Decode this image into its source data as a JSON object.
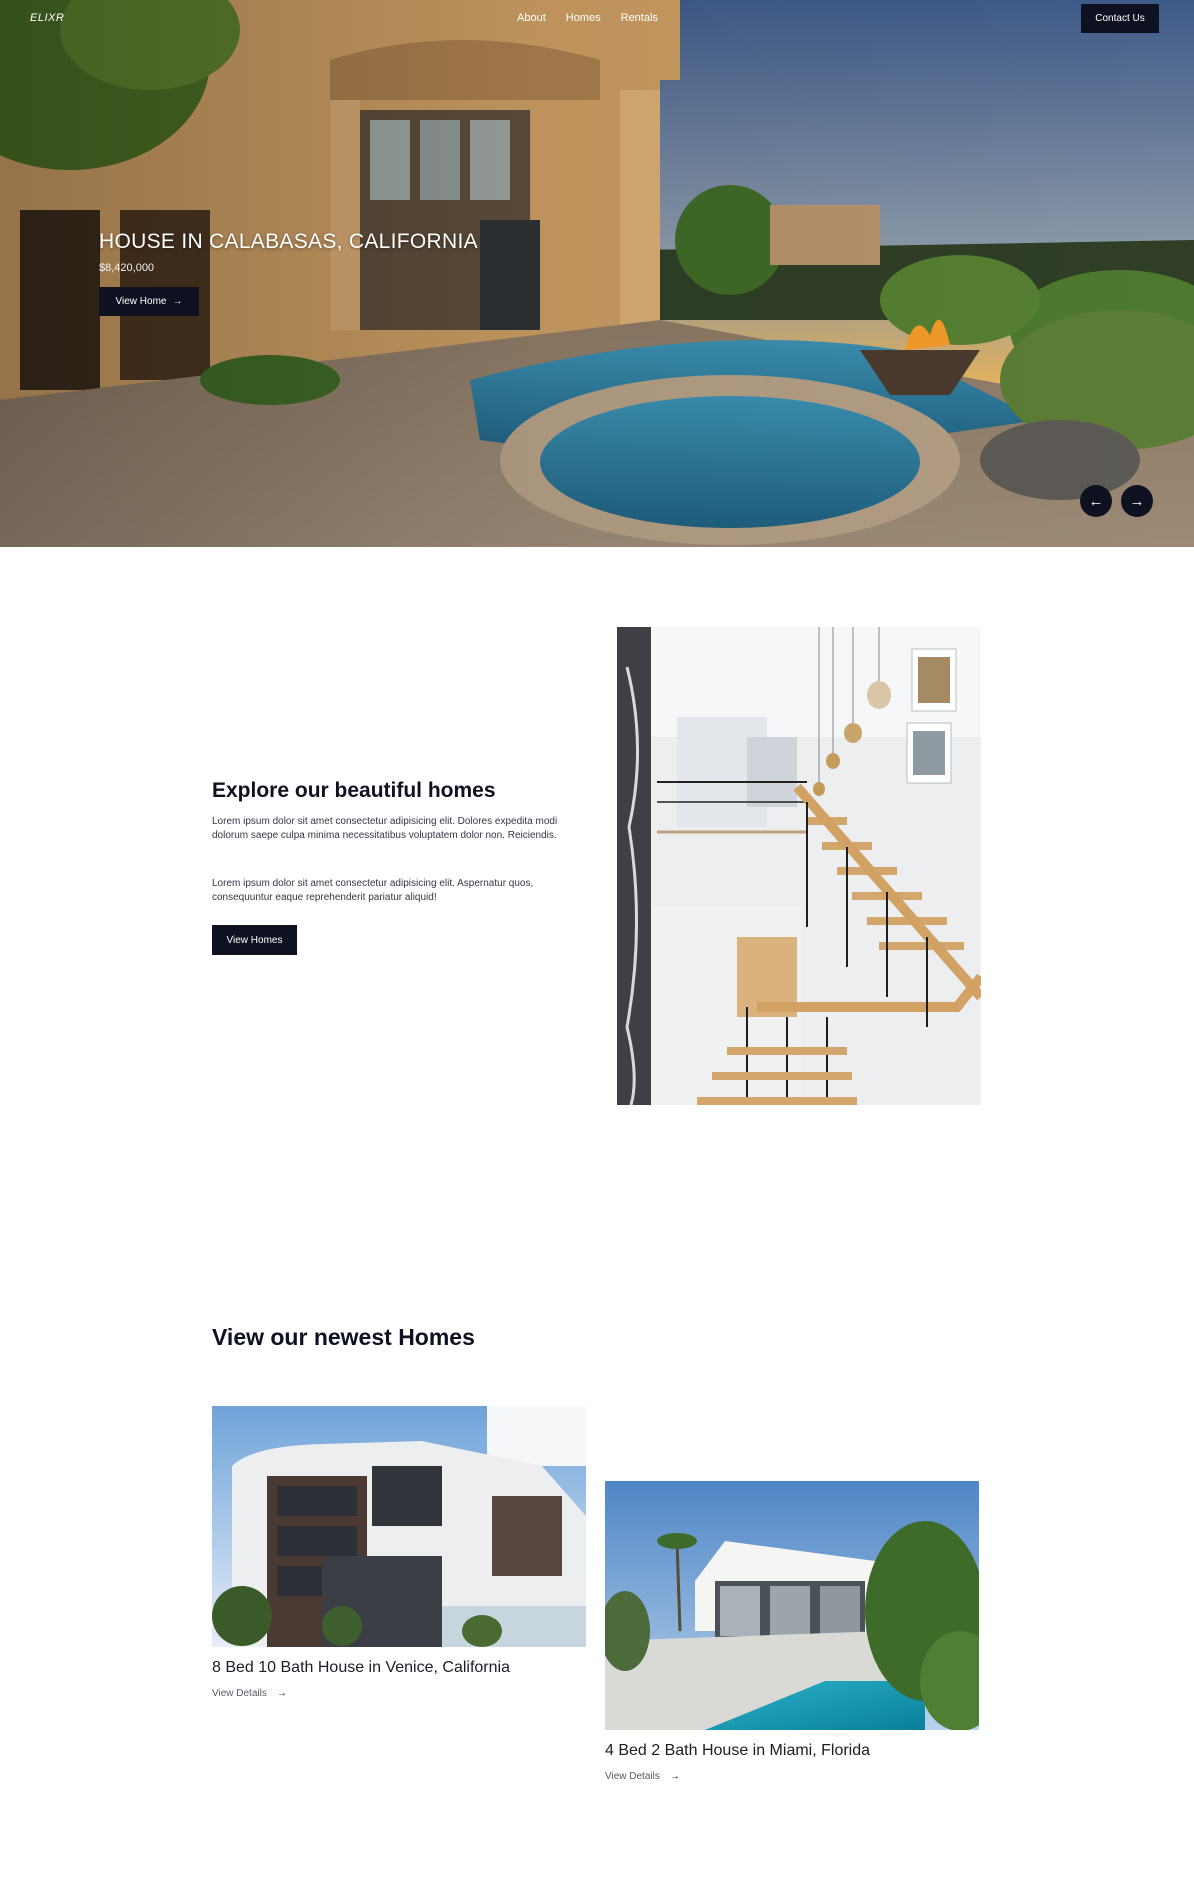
{
  "nav": {
    "logo": "ELIXR",
    "links": [
      "About",
      "Homes",
      "Rentals"
    ],
    "contact_label": "Contact Us"
  },
  "hero": {
    "title": "HOUSE IN CALABASAS, CALIFORNIA",
    "price": "$8,420,000",
    "button_label": "View Home",
    "button_icon": "arrow-right-icon",
    "prev_icon": "arrow-left-icon",
    "next_icon": "arrow-right-icon"
  },
  "explore": {
    "heading": "Explore our beautiful homes",
    "paragraph1": "Lorem ipsum dolor sit amet consectetur adipisicing elit. Dolores expedita modi dolorum saepe culpa minima necessitatibus voluptatem dolor non. Reiciendis.",
    "paragraph2": "Lorem ipsum dolor sit amet consectetur adipisicing elit. Aspernatur quos, consequuntur eaque reprehenderit pariatur aliquid!",
    "button_label": "View Homes"
  },
  "newest": {
    "heading": "View our newest Homes",
    "cards": [
      {
        "title": "8 Bed 10 Bath House in Venice, California",
        "link_label": "View Details"
      },
      {
        "title": "4 Bed 2 Bath House in Miami, Florida",
        "link_label": "View Details"
      }
    ]
  },
  "colors": {
    "primary_dark": "#0e1220",
    "white": "#ffffff",
    "text": "#333844"
  }
}
